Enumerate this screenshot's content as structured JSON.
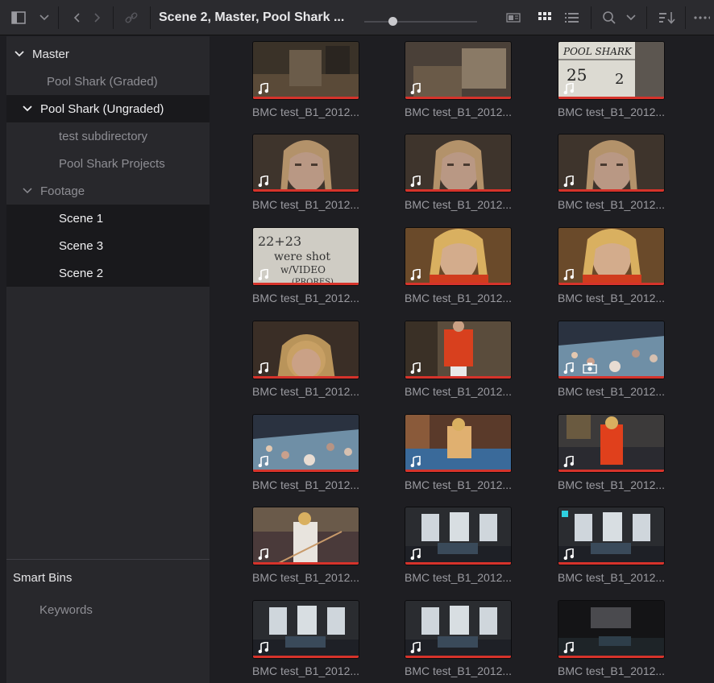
{
  "toolbar": {
    "title": "Scene 2, Master, Pool Shark ...",
    "icons": [
      "sidebar-toggle-icon",
      "chevron-down-icon",
      "back-icon",
      "forward-icon",
      "link-icon",
      "slider",
      "metadata-view-icon",
      "thumbnail-view-icon",
      "list-view-icon",
      "search-icon",
      "chevron-down-icon",
      "sort-icon",
      "more-icon"
    ]
  },
  "sidebar": {
    "tree": [
      {
        "label": "Master",
        "level": 0,
        "expanded": true,
        "selected": false,
        "dim": false
      },
      {
        "label": "Pool Shark (Graded)",
        "level": 1,
        "selected": false,
        "dim": true
      },
      {
        "label": "Pool Shark (Ungraded)",
        "level": 0,
        "expanded": true,
        "selected": true,
        "dim": false
      },
      {
        "label": "test subdirectory",
        "level": 1,
        "selected": false,
        "dim": true
      },
      {
        "label": "Pool Shark Projects",
        "level": 1,
        "selected": false,
        "dim": true
      },
      {
        "label": "Footage",
        "level": 0,
        "expanded": true,
        "selected": false,
        "dim": true
      },
      {
        "label": "Scene 1",
        "level": 1,
        "selected": true,
        "dim": false
      },
      {
        "label": "Scene 3",
        "level": 1,
        "selected": true,
        "dim": false
      },
      {
        "label": "Scene 2",
        "level": 1,
        "selected": true,
        "dim": false
      }
    ],
    "smart_bins_label": "Smart Bins",
    "keywords_label": "Keywords"
  },
  "clips": [
    {
      "label": "BMC test_B1_2012...",
      "scene": "desk"
    },
    {
      "label": "BMC test_B1_2012...",
      "scene": "desk2"
    },
    {
      "label": "BMC test_B1_2012...",
      "scene": "slate"
    },
    {
      "label": "BMC test_B1_2012...",
      "scene": "face"
    },
    {
      "label": "BMC test_B1_2012...",
      "scene": "face"
    },
    {
      "label": "BMC test_B1_2012...",
      "scene": "face"
    },
    {
      "label": "BMC test_B1_2012...",
      "scene": "note"
    },
    {
      "label": "BMC test_B1_2012...",
      "scene": "blonde"
    },
    {
      "label": "BMC test_B1_2012...",
      "scene": "blonde"
    },
    {
      "label": "BMC test_B1_2012...",
      "scene": "blonde2"
    },
    {
      "label": "BMC test_B1_2012...",
      "scene": "jacket"
    },
    {
      "label": "BMC test_B1_2012...",
      "scene": "pool",
      "camera": true
    },
    {
      "label": "BMC test_B1_2012...",
      "scene": "pool"
    },
    {
      "label": "BMC test_B1_2012...",
      "scene": "pooljacket"
    },
    {
      "label": "BMC test_B1_2012...",
      "scene": "chalk"
    },
    {
      "label": "BMC test_B1_2012...",
      "scene": "cue"
    },
    {
      "label": "BMC test_B1_2012...",
      "scene": "room"
    },
    {
      "label": "BMC test_B1_2012...",
      "scene": "room",
      "marker": true
    },
    {
      "label": "BMC test_B1_2012...",
      "scene": "room"
    },
    {
      "label": "BMC test_B1_2012...",
      "scene": "room"
    },
    {
      "label": "BMC test_B1_2012...",
      "scene": "dark"
    }
  ],
  "slate_text": "POOL SHARK",
  "note_text": "22+23 were shot w/VIDEO (PRORES)",
  "colors": {
    "accent_red": "#d6332b",
    "marker_cyan": "#2fd0e0",
    "bg": "#1e1e22",
    "sidebar": "#28282c"
  }
}
